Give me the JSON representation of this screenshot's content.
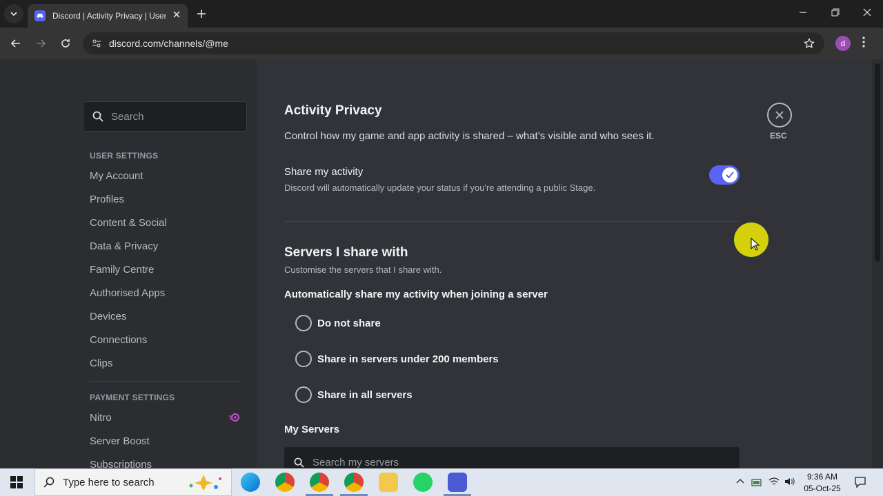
{
  "browser": {
    "tab_title": "Discord | Activity Privacy | User Settings",
    "url": "discord.com/channels/@me",
    "profile_initial": "d"
  },
  "sidebar": {
    "search_placeholder": "Search",
    "user_settings_header": "USER SETTINGS",
    "user_items": [
      "My Account",
      "Profiles",
      "Content & Social",
      "Data & Privacy",
      "Family Centre",
      "Authorised Apps",
      "Devices",
      "Connections",
      "Clips"
    ],
    "payment_settings_header": "PAYMENT SETTINGS",
    "payment_items": [
      "Nitro",
      "Server Boost",
      "Subscriptions"
    ]
  },
  "main": {
    "title": "Activity Privacy",
    "description": "Control how my game and app activity is shared – what’s visible and who sees it.",
    "share_activity": {
      "label": "Share my activity",
      "sub": "Discord will automatically update your status if you're attending a public Stage.",
      "enabled": true
    },
    "servers_heading": "Servers I share with",
    "servers_sub": "Customise the servers that I share with.",
    "auto_share_label": "Automatically share my activity when joining a server",
    "radio_options": [
      "Do not share",
      "Share in servers under 200 members",
      "Share in all servers"
    ],
    "my_servers_label": "My Servers",
    "search_servers_placeholder": "Search my servers",
    "esc_label": "ESC"
  },
  "taskbar": {
    "search_placeholder": "Type here to search",
    "time": "9:36 AM",
    "date": "05-Oct-25"
  },
  "colors": {
    "accent": "#5865f2",
    "sidebar_bg": "#2b2d31",
    "main_bg": "#313338",
    "cursor_highlight": "#d4d00e"
  }
}
